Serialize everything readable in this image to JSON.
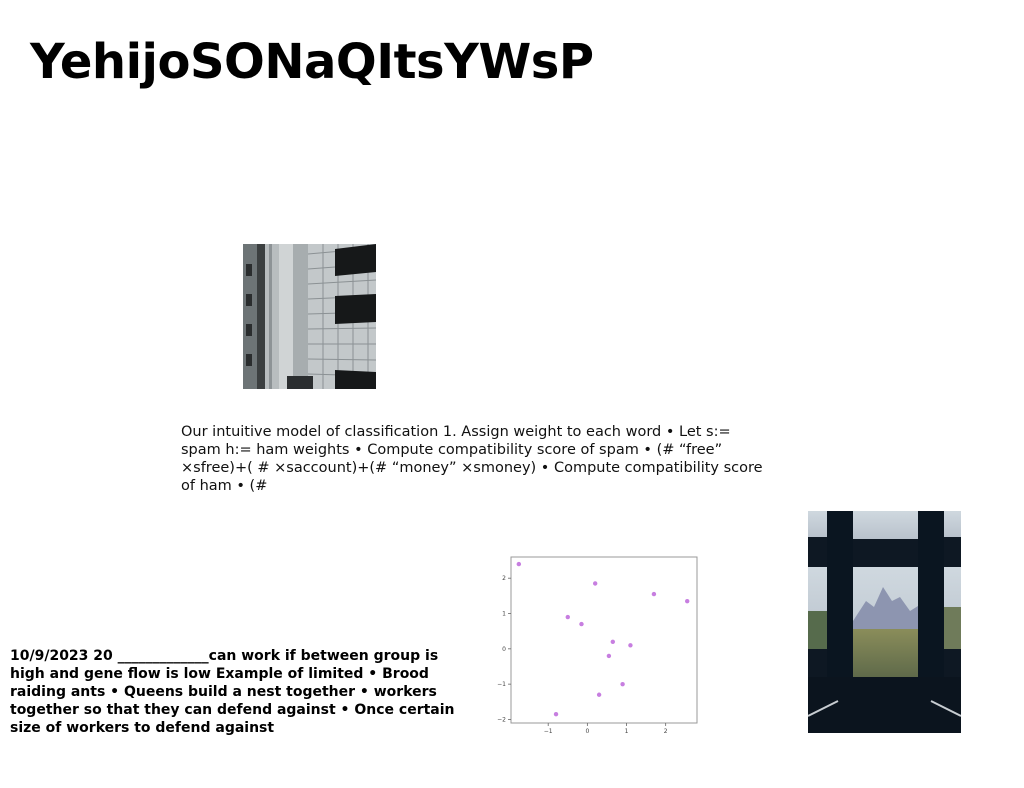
{
  "slide": {
    "title": "YehijoSONaQItsYWsP",
    "paragraph": "Our intuitive model of classification 1. Assign weight to each word • Let s:= spam h:= ham weights • Compute compatibility score of spam • (# “free” ×sfree)+( # ×saccount)+(# “money” ×smoney) • Compute compatibility score of ham • (#",
    "notes": "10/9/2023 20 _____________can work if between group is high and gene flow is low Example of limited • Brood raiding ants • Queens build a nest together • workers together so that they can defend against • Once certain size of workers to defend against"
  },
  "images": {
    "building": "building-photo",
    "window": "window-view-photo"
  },
  "chart_data": {
    "type": "scatter",
    "title": "",
    "xlabel": "",
    "ylabel": "",
    "xlim": [
      -1.95,
      2.8
    ],
    "ylim": [
      -2.1,
      2.6
    ],
    "xticks": [
      -1,
      0,
      1,
      2
    ],
    "yticks": [
      -2,
      -1,
      0,
      1,
      2
    ],
    "x_tick_labels": [
      "−1",
      "0",
      "1",
      "2"
    ],
    "y_tick_labels": [
      "−2",
      "−1",
      "0",
      "1",
      "2"
    ],
    "grid": false,
    "color": "#c77ee0",
    "points": [
      {
        "x": -1.75,
        "y": 2.4
      },
      {
        "x": 0.2,
        "y": 1.85
      },
      {
        "x": 1.7,
        "y": 1.55
      },
      {
        "x": 2.55,
        "y": 1.35
      },
      {
        "x": -0.5,
        "y": 0.9
      },
      {
        "x": -0.15,
        "y": 0.7
      },
      {
        "x": 0.65,
        "y": 0.2
      },
      {
        "x": 1.1,
        "y": 0.1
      },
      {
        "x": 0.55,
        "y": -0.2
      },
      {
        "x": 0.9,
        "y": -1.0
      },
      {
        "x": 0.3,
        "y": -1.3
      },
      {
        "x": -0.8,
        "y": -1.85
      }
    ]
  }
}
